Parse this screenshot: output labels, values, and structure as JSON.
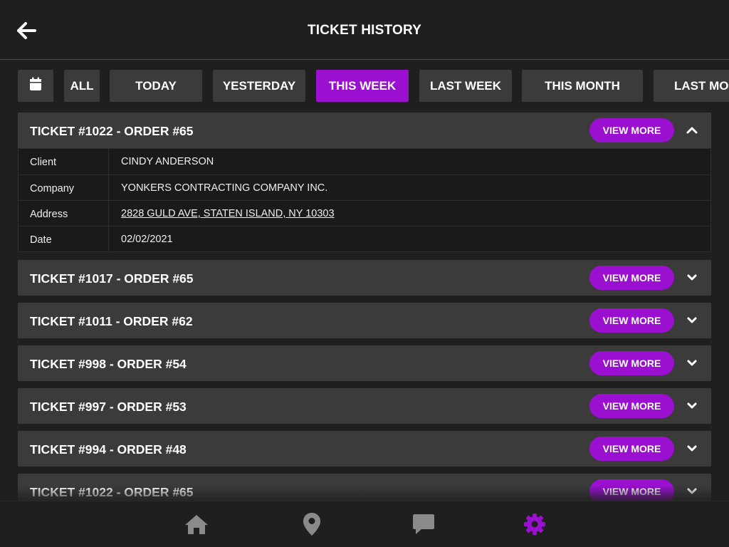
{
  "header": {
    "title": "TICKET HISTORY"
  },
  "filters": [
    "ALL",
    "TODAY",
    "YESTERDAY",
    "THIS WEEK",
    "LAST WEEK",
    "THIS MONTH",
    "LAST MO"
  ],
  "active_filter": "THIS WEEK",
  "tickets": [
    {
      "title": "TICKET #1022 - ORDER #65",
      "button": "VIEW MORE",
      "expanded": true,
      "details": [
        {
          "label": "Client",
          "value": "CINDY ANDERSON"
        },
        {
          "label": "Company",
          "value": "YONKERS CONTRACTING COMPANY INC."
        },
        {
          "label": "Address",
          "value": "2828 GULD AVE, STATEN ISLAND, NY 10303"
        },
        {
          "label": "Date",
          "value": "02/02/2021"
        }
      ]
    },
    {
      "title": "TICKET #1017 - ORDER #65",
      "button": "VIEW MORE",
      "expanded": false
    },
    {
      "title": "TICKET #1011 - ORDER #62",
      "button": "VIEW MORE",
      "expanded": false
    },
    {
      "title": "TICKET #998 - ORDER #54",
      "button": "VIEW MORE",
      "expanded": false
    },
    {
      "title": "TICKET #997 - ORDER #53",
      "button": "VIEW MORE",
      "expanded": false
    },
    {
      "title": "TICKET #994 - ORDER #48",
      "button": "VIEW MORE",
      "expanded": false
    },
    {
      "title": "TICKET #1022 - ORDER #65",
      "button": "VIEW MORE",
      "expanded": false
    }
  ],
  "nav": {
    "items": [
      "home-icon",
      "location-pin-icon",
      "chat-icon",
      "gear-icon"
    ],
    "active": "gear-icon"
  },
  "colors": {
    "accent": "#9a0fd0",
    "background": "#1f1f1f",
    "card": "#3b3b3b",
    "icon_inactive": "#8a8a8a"
  }
}
